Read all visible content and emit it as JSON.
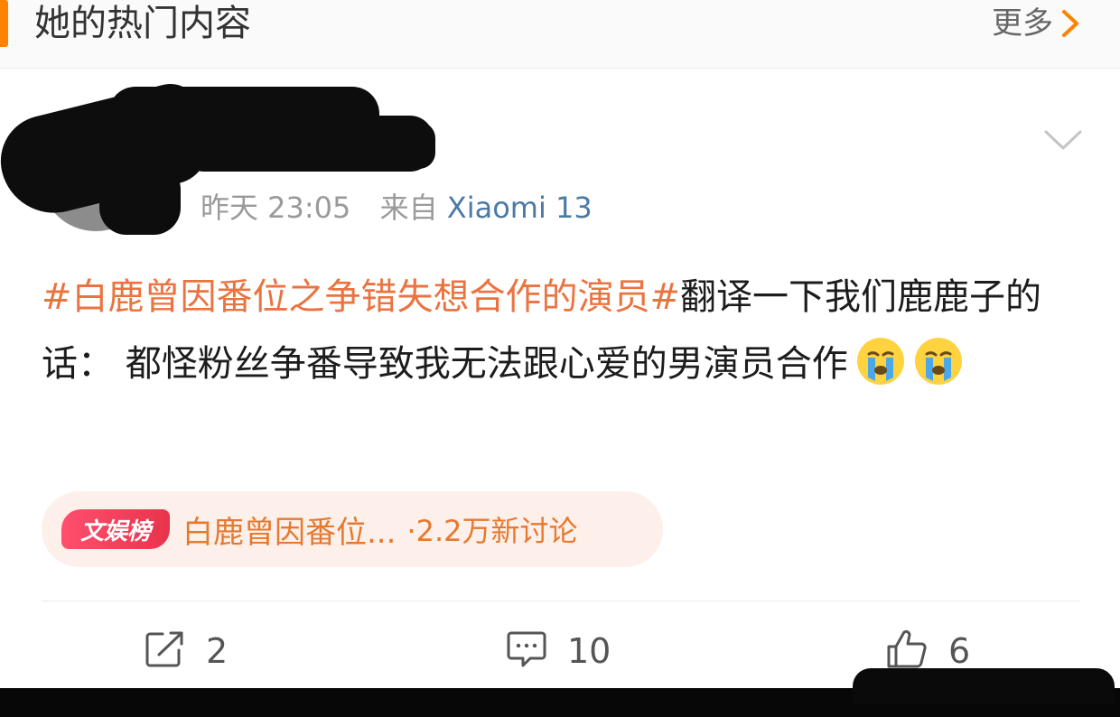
{
  "header": {
    "title": "她的热门内容",
    "more_label": "更多",
    "accent_color": "#ff8200"
  },
  "post": {
    "meta_time": "昨天 23:05",
    "meta_from": "来自",
    "meta_source": "Xiaomi 13",
    "topic": "#白鹿曾因番位之争错失想合作的演员#",
    "body": "翻译一下我们鹿鹿子的话： 都怪粉丝争番导致我无法跟心爱的男演员合作",
    "emojis": [
      "crying-face-emoji",
      "crying-face-emoji"
    ],
    "topic_color": "#eb7340"
  },
  "hot_tag": {
    "badge": "文娱榜",
    "title": "白鹿曾因番位...",
    "count": "·2.2万新讨论"
  },
  "actions": {
    "repost_count": "2",
    "comment_count": "10",
    "like_count": "6"
  }
}
